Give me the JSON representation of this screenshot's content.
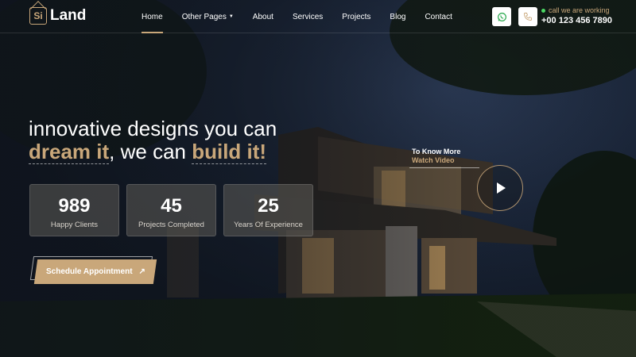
{
  "brand": {
    "mark": "Si",
    "name": "Land",
    "accent": "#c9a77a"
  },
  "nav": {
    "items": [
      {
        "label": "Home",
        "active": true
      },
      {
        "label": "Other Pages",
        "dropdown": true
      },
      {
        "label": "About"
      },
      {
        "label": "Services"
      },
      {
        "label": "Projects"
      },
      {
        "label": "Blog"
      },
      {
        "label": "Contact"
      }
    ]
  },
  "header": {
    "whatsapp_icon": "whatsapp-icon",
    "phone_icon": "phone-icon",
    "status": "call we are working",
    "phone": "+00 123 456 7890"
  },
  "hero": {
    "line1": "innovative designs you can",
    "accent1": "dream it",
    "mid": ", we can ",
    "accent2": "build it!",
    "stats": [
      {
        "value": "989",
        "label": "Happy Clients"
      },
      {
        "value": "45",
        "label": "Projects Completed"
      },
      {
        "value": "25",
        "label": "Years Of Experience"
      }
    ],
    "cta": "Schedule Appointment",
    "video_line1": "To Know More",
    "video_line2": "Watch Video"
  }
}
